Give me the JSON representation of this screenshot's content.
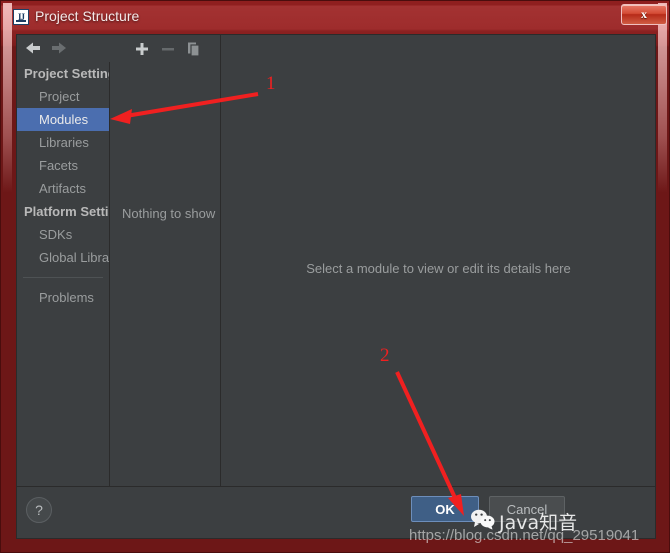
{
  "window": {
    "title": "Project Structure",
    "app_icon": "intellij-idea-icon",
    "close_label": "x"
  },
  "nav": {
    "back": "back-arrow-icon",
    "forward": "forward-arrow-icon"
  },
  "sidebar": {
    "groups": [
      {
        "label": "Project Setting",
        "items": [
          {
            "label": "Project",
            "selected": false
          },
          {
            "label": "Modules",
            "selected": true
          },
          {
            "label": "Libraries",
            "selected": false
          },
          {
            "label": "Facets",
            "selected": false
          },
          {
            "label": "Artifacts",
            "selected": false
          }
        ]
      },
      {
        "label": "Platform Settin",
        "items": [
          {
            "label": "SDKs",
            "selected": false
          },
          {
            "label": "Global Librar",
            "selected": false
          }
        ]
      }
    ],
    "footer_items": [
      {
        "label": "Problems",
        "selected": false
      }
    ]
  },
  "middle_panel": {
    "toolbar": [
      {
        "icon": "plus-icon",
        "enabled": true
      },
      {
        "icon": "minus-icon",
        "enabled": false
      },
      {
        "icon": "copy-icon",
        "enabled": true
      }
    ],
    "empty_text": "Nothing to show"
  },
  "detail_panel": {
    "hint": "Select a module to view or edit its details here"
  },
  "buttons": {
    "help": "?",
    "ok": "OK",
    "cancel": "Cancel"
  },
  "annotations": [
    {
      "label": "1"
    },
    {
      "label": "2"
    }
  ],
  "watermark": {
    "url": "https://blog.csdn.net/qq_29519041",
    "brand": "Java知音",
    "icon": "wechat-icon"
  },
  "colors": {
    "frame": "#7d1c1c",
    "panel": "#3c3f41",
    "selection": "#4b6eaf",
    "ok_button": "#3f5f86",
    "annotation": "#f02020"
  }
}
